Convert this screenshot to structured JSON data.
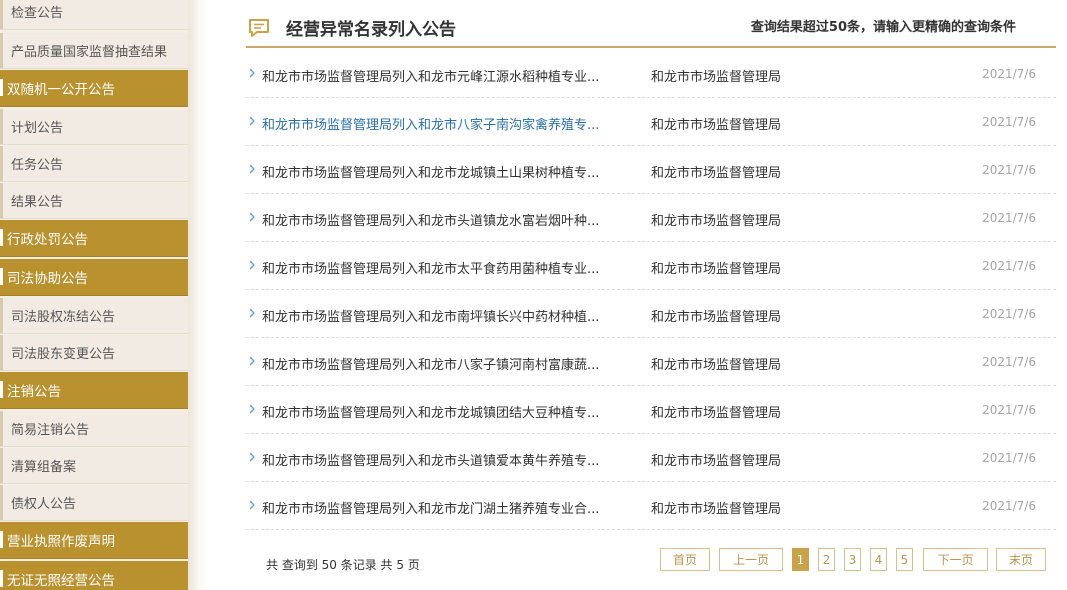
{
  "sidebar": {
    "items": [
      {
        "label": "检查公告",
        "type": "sub"
      },
      {
        "label": "产品质量国家监督抽查结果",
        "type": "sub"
      },
      {
        "label": "双随机一公开公告",
        "type": "cat"
      },
      {
        "label": "计划公告",
        "type": "sub"
      },
      {
        "label": "任务公告",
        "type": "sub"
      },
      {
        "label": "结果公告",
        "type": "sub"
      },
      {
        "label": "行政处罚公告",
        "type": "cat"
      },
      {
        "label": "司法协助公告",
        "type": "cat"
      },
      {
        "label": "司法股权冻结公告",
        "type": "sub"
      },
      {
        "label": "司法股东变更公告",
        "type": "sub"
      },
      {
        "label": "注销公告",
        "type": "cat"
      },
      {
        "label": "简易注销公告",
        "type": "sub"
      },
      {
        "label": "清算组备案",
        "type": "sub"
      },
      {
        "label": "债权人公告",
        "type": "sub"
      },
      {
        "label": "营业执照作废声明",
        "type": "cat"
      },
      {
        "label": "无证无照经营公告",
        "type": "cat"
      }
    ]
  },
  "header": {
    "icon": "announcement-icon",
    "title": "经营异常名录列入公告",
    "note": "查询结果超过50条，请输入更精确的查询条件"
  },
  "rows": [
    {
      "title": "和龙市市场监督管理局列入和龙市元峰江源水稻种植专业...",
      "org": "和龙市市场监督管理局",
      "date": "2021/7/6",
      "highlight": false
    },
    {
      "title": "和龙市市场监督管理局列入和龙市八家子南沟家禽养殖专...",
      "org": "和龙市市场监督管理局",
      "date": "2021/7/6",
      "highlight": true
    },
    {
      "title": "和龙市市场监督管理局列入和龙市龙城镇土山果树种植专...",
      "org": "和龙市市场监督管理局",
      "date": "2021/7/6",
      "highlight": false
    },
    {
      "title": "和龙市市场监督管理局列入和龙市头道镇龙水富岩烟叶种...",
      "org": "和龙市市场监督管理局",
      "date": "2021/7/6",
      "highlight": false
    },
    {
      "title": "和龙市市场监督管理局列入和龙市太平食药用菌种植专业...",
      "org": "和龙市市场监督管理局",
      "date": "2021/7/6",
      "highlight": false
    },
    {
      "title": "和龙市市场监督管理局列入和龙市南坪镇长兴中药材种植...",
      "org": "和龙市市场监督管理局",
      "date": "2021/7/6",
      "highlight": false
    },
    {
      "title": "和龙市市场监督管理局列入和龙市八家子镇河南村富康蔬...",
      "org": "和龙市市场监督管理局",
      "date": "2021/7/6",
      "highlight": false
    },
    {
      "title": "和龙市市场监督管理局列入和龙市龙城镇团结大豆种植专...",
      "org": "和龙市市场监督管理局",
      "date": "2021/7/6",
      "highlight": false
    },
    {
      "title": "和龙市市场监督管理局列入和龙市头道镇爱本黄牛养殖专...",
      "org": "和龙市市场监督管理局",
      "date": "2021/7/6",
      "highlight": false
    },
    {
      "title": "和龙市市场监督管理局列入和龙市龙门湖土猪养殖专业合...",
      "org": "和龙市市场监督管理局",
      "date": "2021/7/6",
      "highlight": false
    }
  ],
  "footer": {
    "summary": "共 查询到 50 条记录 共 5 页"
  },
  "pager": {
    "first": "首页",
    "prev": "上一页",
    "pages": [
      "1",
      "2",
      "3",
      "4",
      "5"
    ],
    "current": "1",
    "next": "下一页",
    "last": "末页"
  },
  "colors": {
    "accent": "#b9912f",
    "sidebar_bg": "#f2ebe3",
    "link_highlight": "#2a6fa8",
    "date": "#a4a4a4"
  }
}
